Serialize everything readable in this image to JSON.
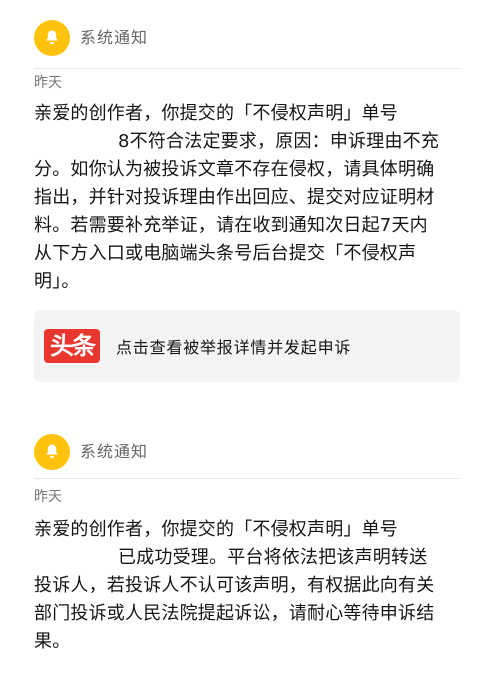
{
  "notifications": [
    {
      "title": "系统通知",
      "date": "昨天",
      "body_lines": [
        "亲爱的创作者，你提交的「不侵权声明」单号",
        "8不符合法定要求，原因：申诉理由不充",
        "分。如你认为被投诉文章不存在侵权，请具体明确",
        "指出，并针对投诉理由作出回应、提交对应证明材",
        "料。若需要补充举证，请在收到通知次日起7天内",
        "从下方入口或电脑端头条号后台提交「不侵权声",
        "明」。"
      ],
      "action": {
        "logo_text": "头条",
        "label": "点击查看被举报详情并发起申诉"
      }
    },
    {
      "title": "系统通知",
      "date": "昨天",
      "body_lines": [
        "亲爱的创作者，你提交的「不侵权声明」单号",
        "已成功受理。平台将依法把该声明转送",
        "投诉人，若投诉人不认可该声明，有权据此向有关",
        "部门投诉或人民法院提起诉讼，请耐心等待申诉结",
        "果。"
      ]
    }
  ],
  "colors": {
    "bell_bg": "#ffc20d",
    "logo_bg": "#e8372f",
    "action_bg": "#f4f4f4"
  }
}
